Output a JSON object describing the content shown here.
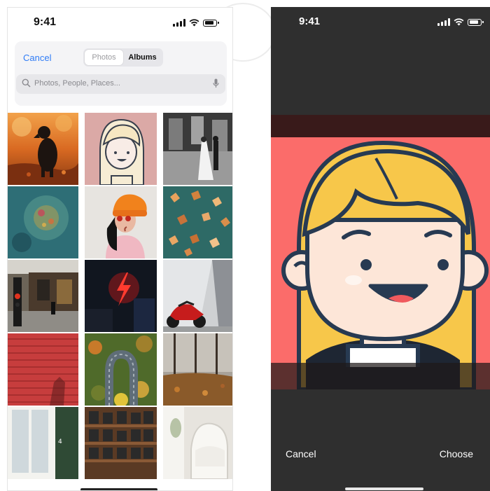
{
  "left_screen": {
    "status_time": "9:41",
    "header": {
      "cancel_label": "Cancel",
      "segments": [
        {
          "label": "Photos",
          "selected": false
        },
        {
          "label": "Albums",
          "selected": true
        }
      ],
      "search_placeholder": "Photos, People, Places..."
    },
    "photos": [
      {
        "icon": "dog-in-leaves-photo"
      },
      {
        "icon": "girl-avatar-photo"
      },
      {
        "icon": "wedding-couple-photo"
      },
      {
        "icon": "bokeh-blur-photo"
      },
      {
        "icon": "woman-orange-beanie-photo"
      },
      {
        "icon": "autumn-leaves-photo"
      },
      {
        "icon": "street-traffic-light-photo"
      },
      {
        "icon": "neon-lightning-photo"
      },
      {
        "icon": "red-motorcycle-photo"
      },
      {
        "icon": "red-shutter-photo"
      },
      {
        "icon": "aerial-winding-road-photo"
      },
      {
        "icon": "autumn-park-photo"
      },
      {
        "icon": "window-door-photo"
      },
      {
        "icon": "bookshelf-photo"
      },
      {
        "icon": "white-chair-photo"
      }
    ]
  },
  "right_screen": {
    "status_time": "9:41",
    "cancel_label": "Cancel",
    "choose_label": "Choose",
    "crop_image": "girl-avatar-illustration",
    "colors": {
      "background": "#fb6c6a",
      "hair": "#f7c74a",
      "skin": "#fde6d8",
      "outline": "#273a52"
    }
  }
}
